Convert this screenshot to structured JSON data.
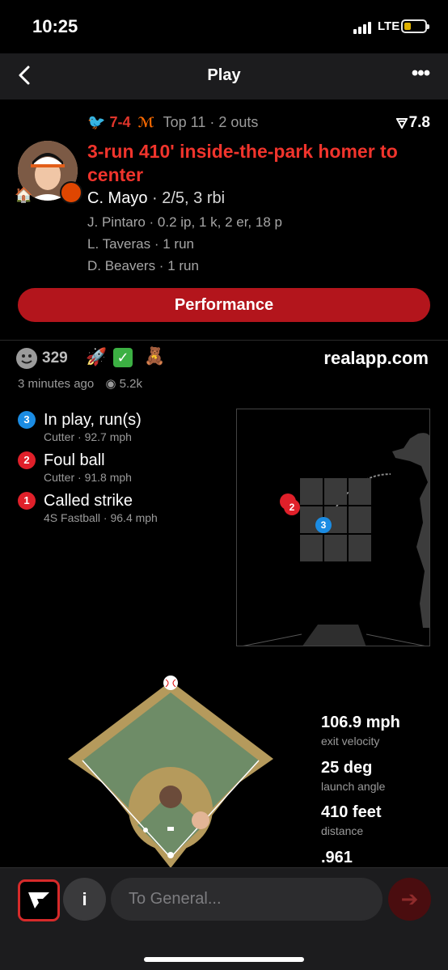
{
  "status_bar": {
    "time": "10:25",
    "network": "LTE"
  },
  "nav": {
    "title": "Play"
  },
  "play": {
    "away_score": "7",
    "home_score": "4",
    "score_separator": "-",
    "inning_info": "Top 11 · 2 outs",
    "rating": "7.8",
    "headline": "3-run 410' inside-the-park homer to center",
    "batter_name": "C. Mayo",
    "batter_line": " · 2/5, 3 rbi",
    "other_lines": [
      "J. Pintaro · 0.2 ip, 1 k, 2 er, 18 p",
      "L. Taveras · 1 run",
      "D. Beavers · 1 run"
    ],
    "performance_button": "Performance"
  },
  "social": {
    "reaction_count": "329",
    "source": "realapp.com",
    "time_ago": "3 minutes ago",
    "views": "5.2k"
  },
  "pitches": [
    {
      "num": "3",
      "result": "In play, run(s)",
      "detail": "Cutter · 92.7 mph",
      "color": "#1b8ce3"
    },
    {
      "num": "2",
      "result": "Foul ball",
      "detail": "Cutter · 91.8 mph",
      "color": "#e0202a"
    },
    {
      "num": "1",
      "result": "Called strike",
      "detail": "4S Fastball · 96.4 mph",
      "color": "#e0202a"
    }
  ],
  "hit_stats": [
    {
      "value": "106.9 mph",
      "label": "exit velocity"
    },
    {
      "value": "25 deg",
      "label": "launch angle"
    },
    {
      "value": "410 feet",
      "label": "distance"
    },
    {
      "value": ".961",
      "label": ""
    }
  ],
  "composer": {
    "info_label": "i",
    "placeholder": "To General..."
  }
}
